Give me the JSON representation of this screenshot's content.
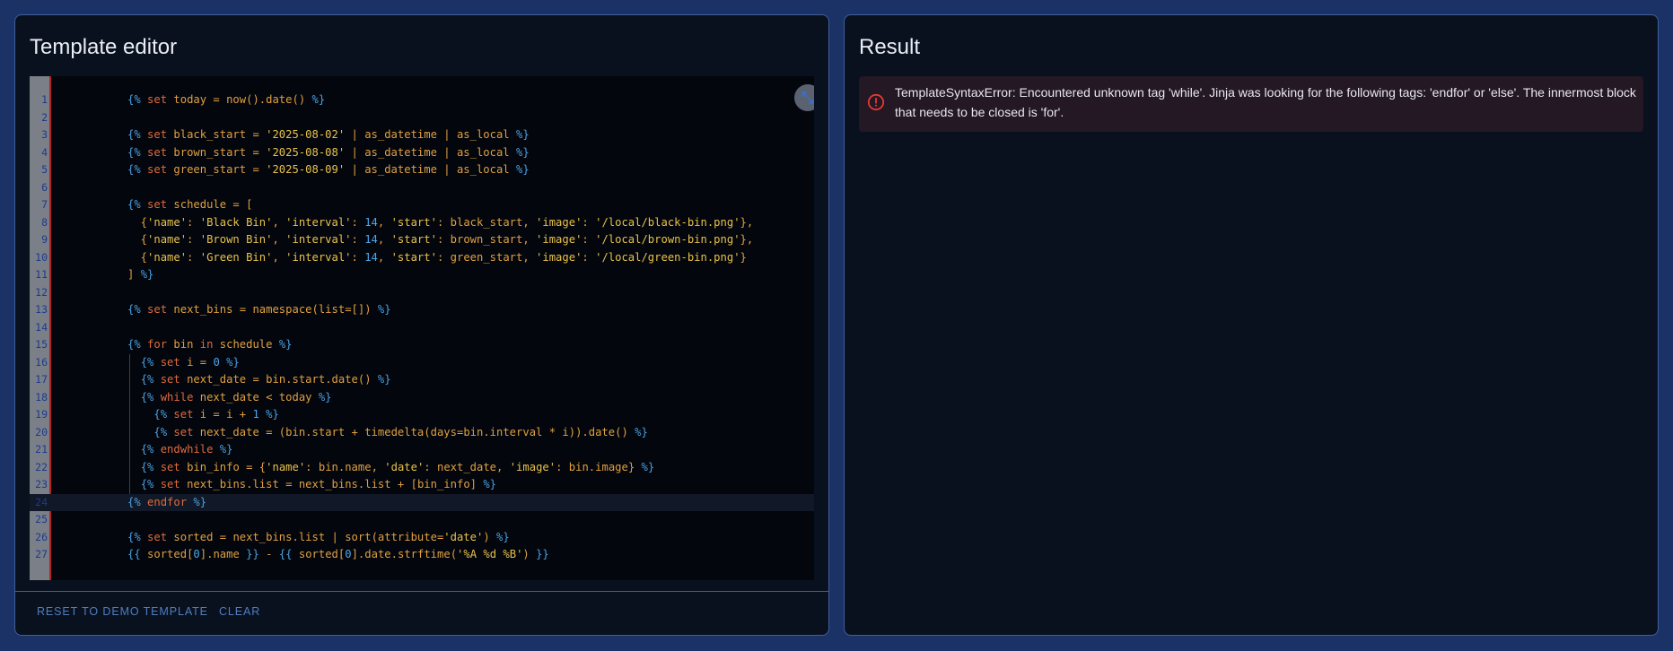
{
  "editor": {
    "title": "Template editor",
    "code_lines": [
      "{% set today = now().date() %}",
      "",
      "{% set black_start = '2025-08-02' | as_datetime | as_local %}",
      "{% set brown_start = '2025-08-08' | as_datetime | as_local %}",
      "{% set green_start = '2025-08-09' | as_datetime | as_local %}",
      "",
      "{% set schedule = [",
      "  {'name': 'Black Bin', 'interval': 14, 'start': black_start, 'image': '/local/black-bin.png'},",
      "  {'name': 'Brown Bin', 'interval': 14, 'start': brown_start, 'image': '/local/brown-bin.png'},",
      "  {'name': 'Green Bin', 'interval': 14, 'start': green_start, 'image': '/local/green-bin.png'}",
      "] %}",
      "",
      "{% set next_bins = namespace(list=[]) %}",
      "",
      "{% for bin in schedule %}",
      "  {% set i = 0 %}",
      "  {% set next_date = bin.start.date() %}",
      "  {% while next_date < today %}",
      "    {% set i = i + 1 %}",
      "    {% set next_date = (bin.start + timedelta(days=bin.interval * i)).date() %}",
      "  {% endwhile %}",
      "  {% set bin_info = {'name': bin.name, 'date': next_date, 'image': bin.image} %}",
      "  {% set next_bins.list = next_bins.list + [bin_info] %}",
      "{% endfor %}",
      "",
      "{% set sorted = next_bins.list | sort(attribute='date') %}",
      "{{ sorted[0].name }} - {{ sorted[0].date.strftime('%A %d %B') }}"
    ],
    "active_line": 24,
    "reset_label": "RESET TO DEMO TEMPLATE",
    "clear_label": "CLEAR",
    "expand_icon": "expand-icon"
  },
  "result": {
    "title": "Result",
    "error_icon": "alert-circle-icon",
    "error_message": "TemplateSyntaxError: Encountered unknown tag 'while'. Jinja was looking for the following tags: 'endfor' or 'else'. The innermost block that needs to be closed is 'for'."
  },
  "colors": {
    "background": "#1b3266",
    "card": "#09111f",
    "delimiter": "#4aa0e0",
    "keyword": "#e06b3c",
    "identifier": "#e0a040",
    "string": "#e8c14a",
    "number": "#4aa8e8",
    "error": "#e53935"
  }
}
